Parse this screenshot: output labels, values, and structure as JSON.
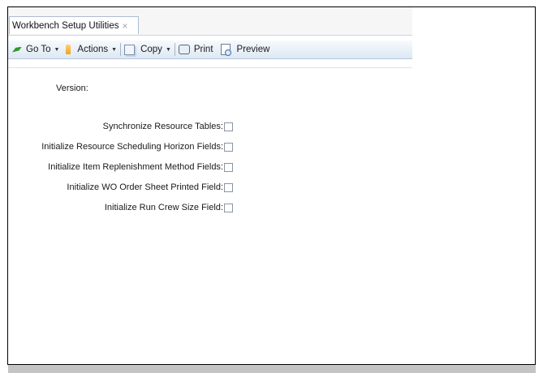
{
  "tab": {
    "title": "Workbench Setup Utilities",
    "close_glyph": "×"
  },
  "toolbar": {
    "goto_label": "Go To",
    "actions_label": "Actions",
    "copy_label": "Copy",
    "print_label": "Print",
    "preview_label": "Preview",
    "dropdown_glyph": "▼"
  },
  "form": {
    "version_label": "Version:",
    "fields": [
      {
        "label": "Synchronize Resource Tables:",
        "checked": false
      },
      {
        "label": "Initialize Resource Scheduling Horizon Fields:",
        "checked": false
      },
      {
        "label": "Initialize Item Replenishment Method Fields:",
        "checked": false
      },
      {
        "label": "Initialize WO Order Sheet Printed Field:",
        "checked": false
      },
      {
        "label": "Initialize Run Crew Size Field:",
        "checked": false
      }
    ]
  }
}
